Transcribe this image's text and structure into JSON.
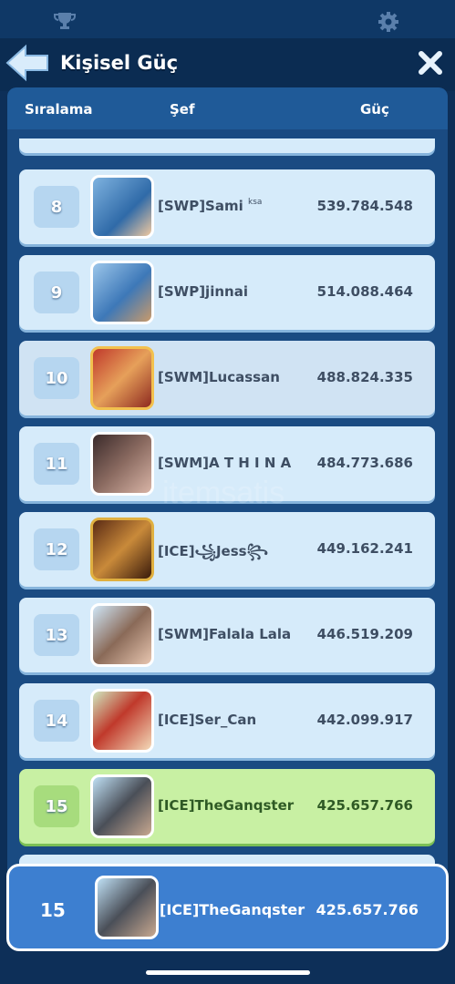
{
  "window": {
    "title": "Kişisel Güç"
  },
  "icons": {
    "top_left": "trophy-icon",
    "top_right": "gear-icon",
    "back": "back-arrow-icon",
    "close": "close-icon"
  },
  "table": {
    "col_rank": "Sıralama",
    "col_chef": "Şef",
    "col_power": "Güç",
    "rows": [
      {
        "rank": "8",
        "name": "[SWP]Sami",
        "suffix": "ksa",
        "power": "539.784.548"
      },
      {
        "rank": "9",
        "name": "[SWP]jinnai",
        "suffix": "",
        "power": "514.088.464"
      },
      {
        "rank": "10",
        "name": "[SWM]Lucassan",
        "suffix": "",
        "power": "488.824.335"
      },
      {
        "rank": "11",
        "name": "[SWM]A T H I N A",
        "suffix": "",
        "power": "484.773.686"
      },
      {
        "rank": "12",
        "name": "[ICE]꧁Jess꧂",
        "suffix": "",
        "power": "449.162.241"
      },
      {
        "rank": "13",
        "name": "[SWM]Falala Lala",
        "suffix": "",
        "power": "446.519.209"
      },
      {
        "rank": "14",
        "name": "[ICE]Ser_Can",
        "suffix": "",
        "power": "442.099.917"
      },
      {
        "rank": "15",
        "name": "[ICE]TheGanqster",
        "suffix": "",
        "power": "425.657.766"
      }
    ]
  },
  "me": {
    "rank": "15",
    "name": "[ICE]TheGanqster",
    "power": "425.657.766"
  },
  "watermark": "itemsatis",
  "colors": {
    "row": "#d6ebfa",
    "highlight": "#c8f0a3",
    "footer": "#3d7fd0"
  }
}
